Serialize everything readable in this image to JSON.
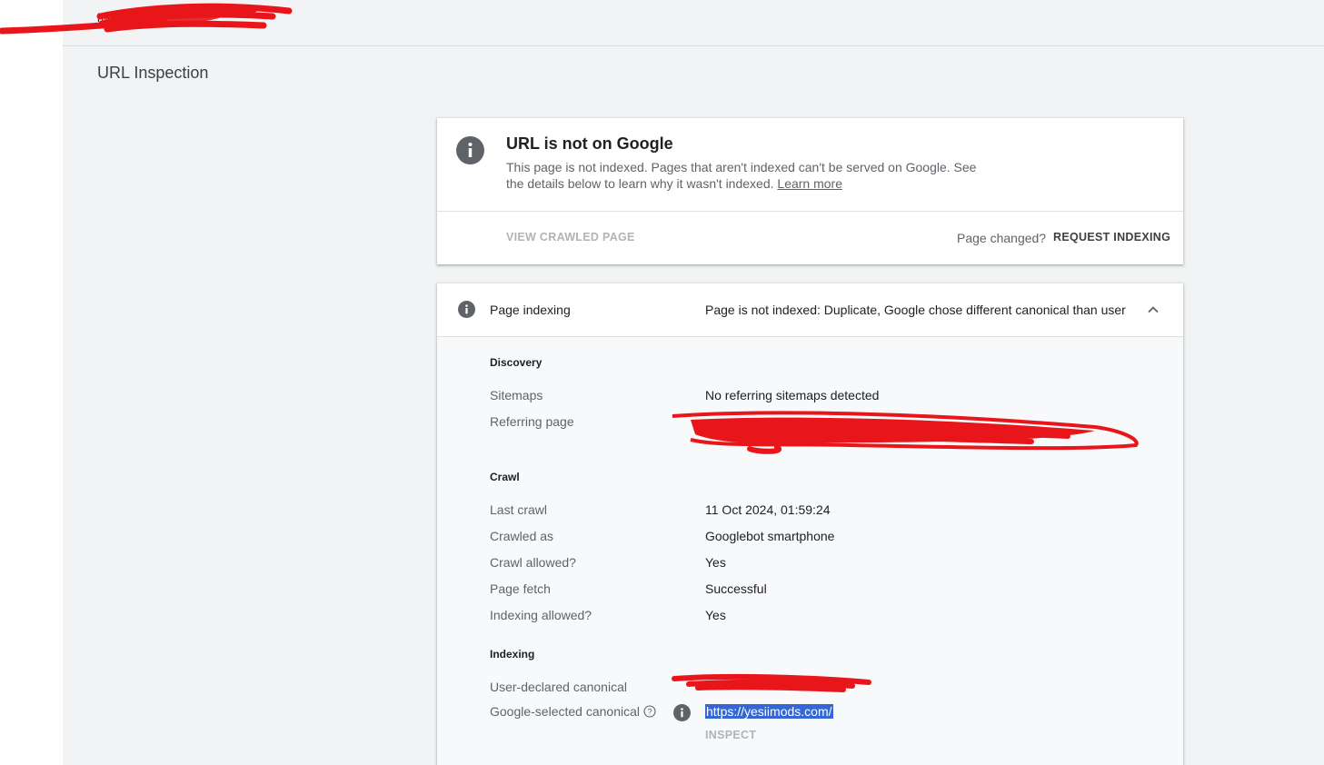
{
  "header": {
    "url_text": "https://",
    "page_title": "URL Inspection"
  },
  "status_card": {
    "icon": "info-icon",
    "title": "URL is not on Google",
    "description": "This page is not indexed. Pages that aren't indexed can't be served on Google. See the details below to learn why it wasn't indexed.",
    "learn_more": "Learn more",
    "view_crawled_page": "VIEW CRAWLED PAGE",
    "page_changed": "Page changed?",
    "request_indexing": "REQUEST INDEXING"
  },
  "indexing_card": {
    "icon": "info-icon",
    "title": "Page indexing",
    "status": "Page is not indexed: Duplicate, Google chose different canonical than user",
    "expand_icon": "chevron-up-icon",
    "sections": {
      "discovery": {
        "heading": "Discovery",
        "sitemaps_label": "Sitemaps",
        "sitemaps_value": "No referring sitemaps detected",
        "referring_page_label": "Referring page",
        "referring_page_value": ""
      },
      "crawl": {
        "heading": "Crawl",
        "last_crawl_label": "Last crawl",
        "last_crawl_value": "11 Oct 2024, 01:59:24",
        "crawled_as_label": "Crawled as",
        "crawled_as_value": "Googlebot smartphone",
        "crawl_allowed_label": "Crawl allowed?",
        "crawl_allowed_value": "Yes",
        "page_fetch_label": "Page fetch",
        "page_fetch_value": "Successful",
        "indexing_allowed_label": "Indexing allowed?",
        "indexing_allowed_value": "Yes"
      },
      "indexing": {
        "heading": "Indexing",
        "user_canonical_label": "User-declared canonical",
        "user_canonical_value": "",
        "google_canonical_label": "Google-selected canonical",
        "google_canonical_value": "https://yesiimods.com/",
        "inspect": "INSPECT"
      }
    }
  },
  "colors": {
    "background": "#f1f3f4",
    "card": "#ffffff",
    "icon_gray": "#5f6368",
    "selection_blue": "#3367d6",
    "redaction_red": "#e8161a"
  }
}
